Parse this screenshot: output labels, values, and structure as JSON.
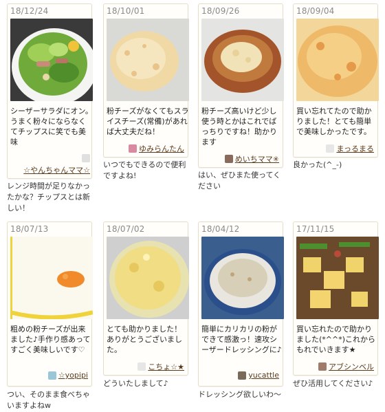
{
  "posts": [
    {
      "date": "18/12/24",
      "message": "シーザーサラダにオン。うまく粉々にならなくてチップスに笑でも美味",
      "user": "☆やんちゃんママ☆",
      "reply": "レンジ時間が足りなかったかな？チップスとは新しい！",
      "avatar_color": "#e0e0e0"
    },
    {
      "date": "18/10/01",
      "message": "粉チーズがなくてもスライスチーズ(常備)があれば大丈夫だね！",
      "user": "ゆみらんたん",
      "reply": "いつでもできるので便利ですよね!",
      "avatar_color": "#d98aa0"
    },
    {
      "date": "18/09/26",
      "message": "粉チーズ高いけど少し使う時とかはこれでばっちりですね！助かります",
      "user": "めいちママ✳",
      "reply": "はい、ぜひまた使ってください",
      "avatar_color": "#8a6a5a"
    },
    {
      "date": "18/09/04",
      "message": "買い忘れてたので助かりました！とても簡単で美味しかったです。",
      "user": "まっるまる",
      "reply": "良かった(^_-)",
      "avatar_color": "#e6e6e6"
    },
    {
      "date": "18/07/13",
      "message": "粗めの粉チーズが出来ました♪手作り感あってすごく美味しいです♡",
      "user": "☆yopipi",
      "reply": "つい、そのまま食べちゃいますよねw",
      "avatar_color": "#9ac6d8"
    },
    {
      "date": "18/07/02",
      "message": "とても助かりました！ありがとうございました。",
      "user": "こちょ☆★",
      "reply": "どういたしまして♪",
      "avatar_color": "#e6e6e6"
    },
    {
      "date": "18/04/12",
      "message": "簡単にカリカリの粉ができて感激っ！速攻シーザードレッシングに♪",
      "user": "yucattle",
      "reply": "ドレッシング欲しいわ〜",
      "avatar_color": "#7a6a5a"
    },
    {
      "date": "17/11/15",
      "message": "買い忘れたので助かりました(*^^*)これからもれでいきます★",
      "user": "アブシンベル",
      "reply": "ぜひ活用してください♪",
      "avatar_color": "#a07a6a"
    }
  ]
}
